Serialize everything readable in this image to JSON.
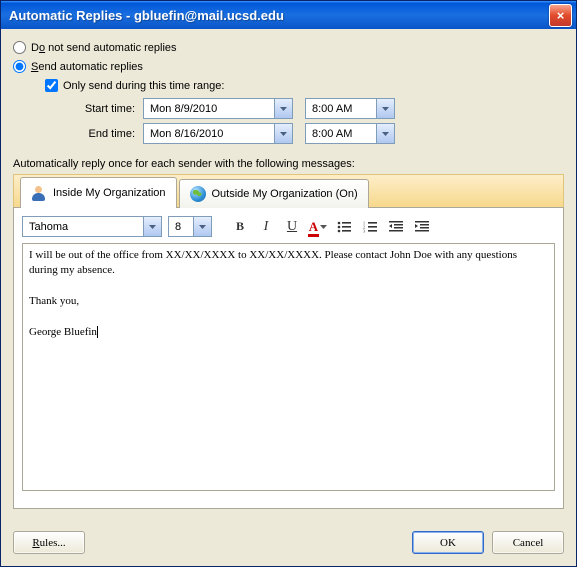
{
  "window": {
    "title": "Automatic Replies - gbluefin@mail.ucsd.edu",
    "close_icon": "×"
  },
  "options": {
    "do_not_send": "Do not send automatic replies",
    "send": "Send automatic replies",
    "only_range": "Only send during this time range:",
    "start_label": "Start time:",
    "end_label": "End time:",
    "start_date": "Mon 8/9/2010",
    "start_time": "8:00 AM",
    "end_date": "Mon 8/16/2010",
    "end_time": "8:00 AM"
  },
  "section_label": "Automatically reply once for each sender with the following messages:",
  "tabs": {
    "inside": "Inside My Organization",
    "outside": "Outside My Organization (On)"
  },
  "toolbar": {
    "font": "Tahoma",
    "size": "8"
  },
  "message": {
    "line1": "I will be out of the office from XX/XX/XXXX to XX/XX/XXXX.  Please contact John Doe with any questions during my absence.",
    "line2": "Thank you,",
    "line3": "George Bluefin"
  },
  "buttons": {
    "rules": "Rules...",
    "ok": "OK",
    "cancel": "Cancel"
  }
}
